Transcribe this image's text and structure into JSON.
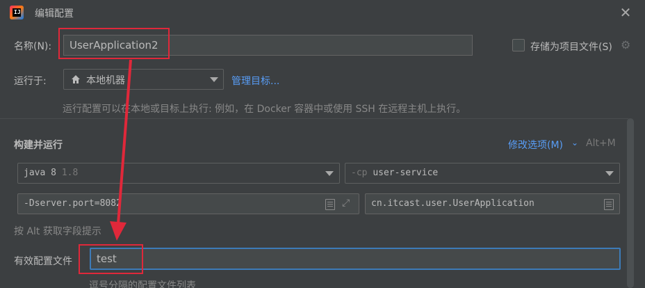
{
  "window": {
    "title": "编辑配置"
  },
  "app_logo": {
    "mark": "IJ"
  },
  "name_field": {
    "label": "名称(N):",
    "value": "UserApplication2"
  },
  "store_as_file": {
    "label": "存储为项目文件(S)",
    "checked": false
  },
  "run_on": {
    "label": "运行于:",
    "value": "本地机器",
    "manage_link": "管理目标...",
    "hint": "运行配置可以在本地或目标上执行: 例如，在 Docker 容器中或使用 SSH 在远程主机上执行。"
  },
  "build_and_run": {
    "title": "构建并运行",
    "modify_options": "修改选项(M)",
    "shortcut": "Alt+M",
    "jdk": {
      "name": "java 8",
      "version": "1.8"
    },
    "classpath": {
      "flag": "-cp",
      "module": "user-service"
    },
    "vm_options": "-Dserver.port=8082",
    "main_class": "cn.itcast.user.UserApplication",
    "alt_hint": "按 Alt 获取字段提示"
  },
  "active_profiles": {
    "label": "有效配置文件",
    "value": "test",
    "hint": "逗号分隔的配置文件列表"
  },
  "colors": {
    "accent_link": "#589df6",
    "annotation_red": "#e0283a",
    "focus_border": "#3d7bb8",
    "background": "#3c3f41"
  }
}
